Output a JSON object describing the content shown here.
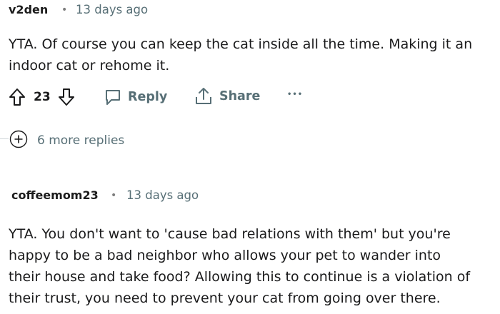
{
  "comment1": {
    "username": "v2den",
    "separator": "•",
    "time": "13 days ago",
    "body_line1": "YTA. Of course you can keep the cat inside all the time. Making it an",
    "body_line2": "indoor cat or rehome it.",
    "vote_count": "23",
    "reply_label": "Reply",
    "share_label": "Share",
    "overflow_label": "•••"
  },
  "more_replies": {
    "label": "6 more replies",
    "icon": "plus-circle-icon"
  },
  "comment2": {
    "username": "coffeemom23",
    "separator": "•",
    "time": "13 days ago",
    "body_line1": "YTA. You don't want to 'cause bad relations with them' but you're",
    "body_line2": "happy to be a bad neighbor who allows your pet to wander into",
    "body_line3": "their house and take food? Allowing this to continue is a violation of",
    "body_line4": "their trust, you need to prevent your cat from going over there."
  }
}
